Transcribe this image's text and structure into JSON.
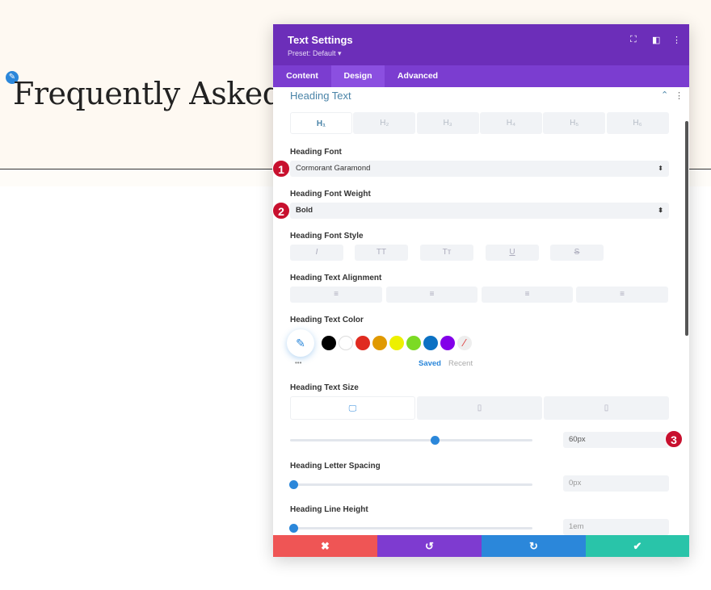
{
  "page": {
    "heading": "Frequently Asked Q"
  },
  "panel": {
    "title": "Text Settings",
    "preset": "Preset: Default ▾",
    "tabs": [
      "Content",
      "Design",
      "Advanced"
    ],
    "active_tab": "Design",
    "section_title": "Heading Text",
    "heading_levels": [
      "H₁",
      "H₂",
      "H₃",
      "H₄",
      "H₅",
      "H₆"
    ],
    "font_label": "Heading Font",
    "font_value": "Cormorant Garamond",
    "weight_label": "Heading Font Weight",
    "weight_value": "Bold",
    "style_label": "Heading Font Style",
    "style_buttons": [
      "I",
      "TT",
      "Tт",
      "U",
      "S"
    ],
    "align_label": "Heading Text Alignment",
    "color_label": "Heading Text Color",
    "swatches": [
      "#000000",
      "#ffffff",
      "#e02b20",
      "#e09900",
      "#edf000",
      "#7cda24",
      "#0c71c3",
      "#8300e9"
    ],
    "saved": "Saved",
    "recent": "Recent",
    "more": "•••",
    "size_label": "Heading Text Size",
    "size_value": "60px",
    "spacing_label": "Heading Letter Spacing",
    "spacing_value": "0px",
    "lineheight_label": "Heading Line Height",
    "lineheight_value": "1em",
    "size_slider": 0.59,
    "spacing_slider": 0.0,
    "lineheight_slider": 0.0,
    "footer": {
      "cancel": "✖",
      "undo": "↺",
      "redo": "↻",
      "save": "✔"
    }
  },
  "badges": [
    "1",
    "2",
    "3"
  ],
  "colors": {
    "header": "#6c2eb9",
    "tabs": "#7b3dd0",
    "accent": "#2b87da",
    "cancel": "#ef5555",
    "undo": "#7e3bd0",
    "redo": "#2b87da",
    "save": "#29c4a9",
    "badge": "#c8102e"
  }
}
